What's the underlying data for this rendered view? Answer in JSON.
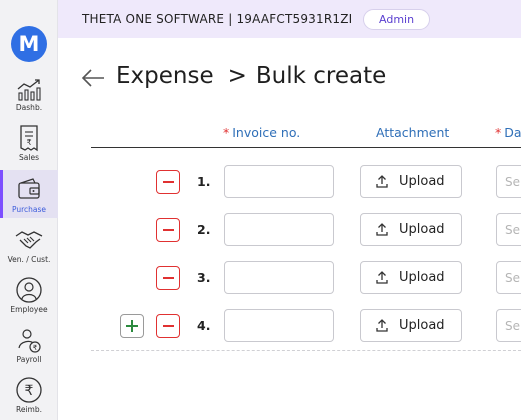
{
  "app": {
    "logo_letter": "M",
    "company": "THETA ONE SOFTWARE | 19AAFCT5931R1ZI",
    "role": "Admin",
    "accent": "#7c4dff",
    "brand": "#2f6fe4"
  },
  "sidebar": {
    "items": [
      {
        "label": "Dashb.",
        "icon": "bar-chart-icon"
      },
      {
        "label": "Sales",
        "icon": "receipt-icon"
      },
      {
        "label": "Purchase",
        "icon": "wallet-icon",
        "active": true
      },
      {
        "label": "Ven. / Cust.",
        "icon": "handshake-icon"
      },
      {
        "label": "Employee",
        "icon": "employee-icon"
      },
      {
        "label": "Payroll",
        "icon": "payroll-icon"
      },
      {
        "label": "Reimb.",
        "icon": "rupee-icon"
      }
    ]
  },
  "page": {
    "section": "Expense",
    "separator": ">",
    "title": "Bulk create"
  },
  "table": {
    "columns": {
      "invoice": {
        "label": "Invoice no.",
        "required": "*"
      },
      "attachment": {
        "label": "Attachment"
      },
      "date": {
        "label": "Da",
        "required": "*"
      }
    },
    "upload_label": "Upload",
    "date_placeholder": "Se",
    "invoice_value": "",
    "rows": [
      {
        "number": "1."
      },
      {
        "number": "2."
      },
      {
        "number": "3."
      },
      {
        "number": "4."
      }
    ]
  }
}
